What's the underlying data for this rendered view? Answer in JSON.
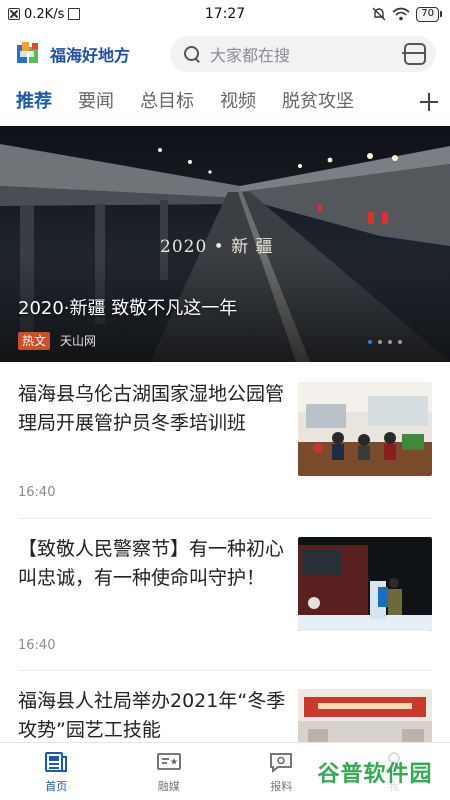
{
  "status_bar": {
    "speed": "0.2K/s",
    "time": "17:27",
    "battery": "70"
  },
  "header": {
    "app_name": "福海好地方",
    "search_placeholder": "大家都在搜"
  },
  "tabs": [
    "推荐",
    "要闻",
    "总目标",
    "视频",
    "脱贫攻坚"
  ],
  "banner": {
    "caption": "2020 • 新 疆",
    "title": "2020·新疆 致敬不凡这一年",
    "tag": "热文",
    "source": "天山网",
    "slides_total": 4,
    "slide_active": 1
  },
  "news": [
    {
      "title": "福海县乌伦古湖国家湿地公园管理局开展管护员冬季培训班",
      "time": "16:40",
      "thumb": "meeting-room-photo"
    },
    {
      "title": "【致敬人民警察节】有一种初心叫忠诚，有一种使命叫守护！",
      "time": "16:40",
      "thumb": "night-police-truck-photo"
    },
    {
      "title": "福海县人社局举办2021年“冬季攻势”园艺工技能",
      "time": "",
      "thumb": "training-hall-photo"
    }
  ],
  "bottom_nav": [
    {
      "label": "首页",
      "icon": "home-news-icon",
      "active": true
    },
    {
      "label": "融媒",
      "icon": "media-card-icon",
      "active": false
    },
    {
      "label": "报料",
      "icon": "report-chat-icon",
      "active": false
    },
    {
      "label": "我",
      "icon": "profile-icon",
      "active": false
    }
  ],
  "watermark": "谷普软件园",
  "colors": {
    "accent": "#1d5aa8",
    "tag": "#c8502a",
    "watermark": "#34a853"
  }
}
